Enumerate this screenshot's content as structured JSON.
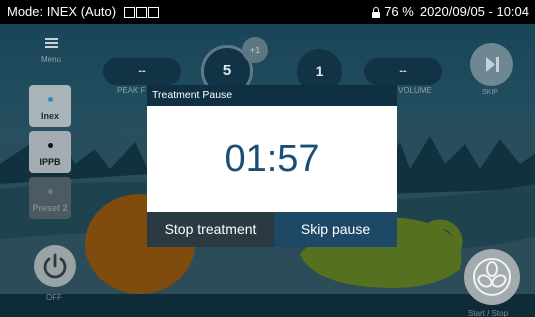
{
  "status_bar": {
    "mode": "Mode: INEX (Auto)",
    "battery": "76 %",
    "datetime": "2020/09/05 - 10:04"
  },
  "sidebar": {
    "menu_label": "Menu",
    "inex_label": "Inex",
    "ippb_label": "IPPB",
    "preset_label": "Preset 2",
    "off_label": "OFF"
  },
  "readouts": {
    "peak_value": "--",
    "peak_label": "PEAK F",
    "cycles_value": "5",
    "cycles_badge": "+1",
    "set_value": "1",
    "volume_value": "--",
    "volume_label": "VOLUME",
    "skip_label": "SKIP",
    "start_stop_label": "Start / Stop"
  },
  "dialog": {
    "title": "Treatment Pause",
    "time": "01:57",
    "stop_label": "Stop treatment",
    "skip_label": "Skip pause"
  },
  "colors": {
    "accent": "#1d4866",
    "title_bar": "#0f2f42",
    "time_text": "#1b4e72"
  }
}
